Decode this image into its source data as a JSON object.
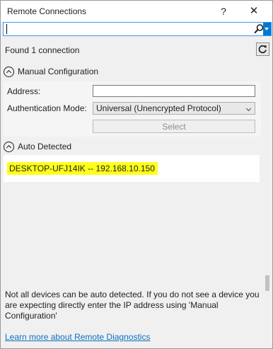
{
  "window": {
    "title": "Remote Connections",
    "help_glyph": "?",
    "close_glyph": "✕"
  },
  "search": {
    "value": "",
    "placeholder": ""
  },
  "status": {
    "found_text": "Found 1 connection"
  },
  "manual_section": {
    "title": "Manual Configuration",
    "address_label": "Address:",
    "address_value": "",
    "auth_label": "Authentication Mode:",
    "auth_value": "Universal (Unencrypted Protocol)",
    "select_label": "Select"
  },
  "auto_section": {
    "title": "Auto Detected",
    "devices": [
      {
        "label": "DESKTOP-UFJ14IK -- 192.168.10.150",
        "highlight_color": "#ffff1c"
      }
    ]
  },
  "footer": {
    "note": "Not all devices can be auto detected. If you do not see a device you are expecting directly enter the IP address using 'Manual Configuration'",
    "link_text": "Learn more about Remote Diagnostics"
  },
  "colors": {
    "accent": "#007acc",
    "focus_border": "#3399ff",
    "link": "#0e70c0",
    "highlight": "#ffff1c"
  },
  "icons": {
    "search": "search-icon",
    "dropdown": "chevron-down-icon",
    "refresh": "refresh-icon",
    "collapse": "chevron-up-circle-icon"
  }
}
